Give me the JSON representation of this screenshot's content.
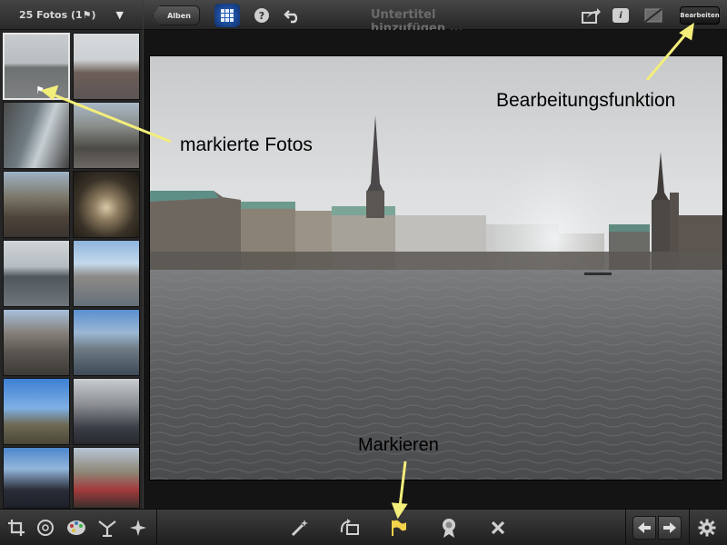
{
  "sidebar": {
    "header_title": "25 Fotos (1⚑)",
    "caret": "▼"
  },
  "topbar": {
    "back_label": "Alben",
    "subtitle_placeholder": "Untertitel hinzufügen ...",
    "info_label": "i",
    "edit_label": "Bearbeiten"
  },
  "annotations": {
    "marked_photos": "markierte Fotos",
    "edit_function": "Bearbeitungsfunktion",
    "flag": "Markieren"
  },
  "icons": {
    "top": [
      "back-arrow",
      "grid-view-icon",
      "help-icon",
      "undo-icon",
      "share-icon",
      "info-icon",
      "compare-icon"
    ],
    "bottom_left": [
      "crop-icon",
      "rotate-icon",
      "palette-icon",
      "sizes-icon",
      "sparkle-icon"
    ],
    "bottom_center": [
      "magic-wand-icon",
      "rotate-photo-icon",
      "flag-icon",
      "award-icon",
      "reject-icon"
    ],
    "bottom_right": [
      "prev-arrow-icon",
      "next-arrow-icon",
      "gear-icon"
    ]
  },
  "colors": {
    "accent_blue": "#2a68c8",
    "annotation_arrow": "#f3ee7a",
    "annotation_text": "#000000"
  }
}
